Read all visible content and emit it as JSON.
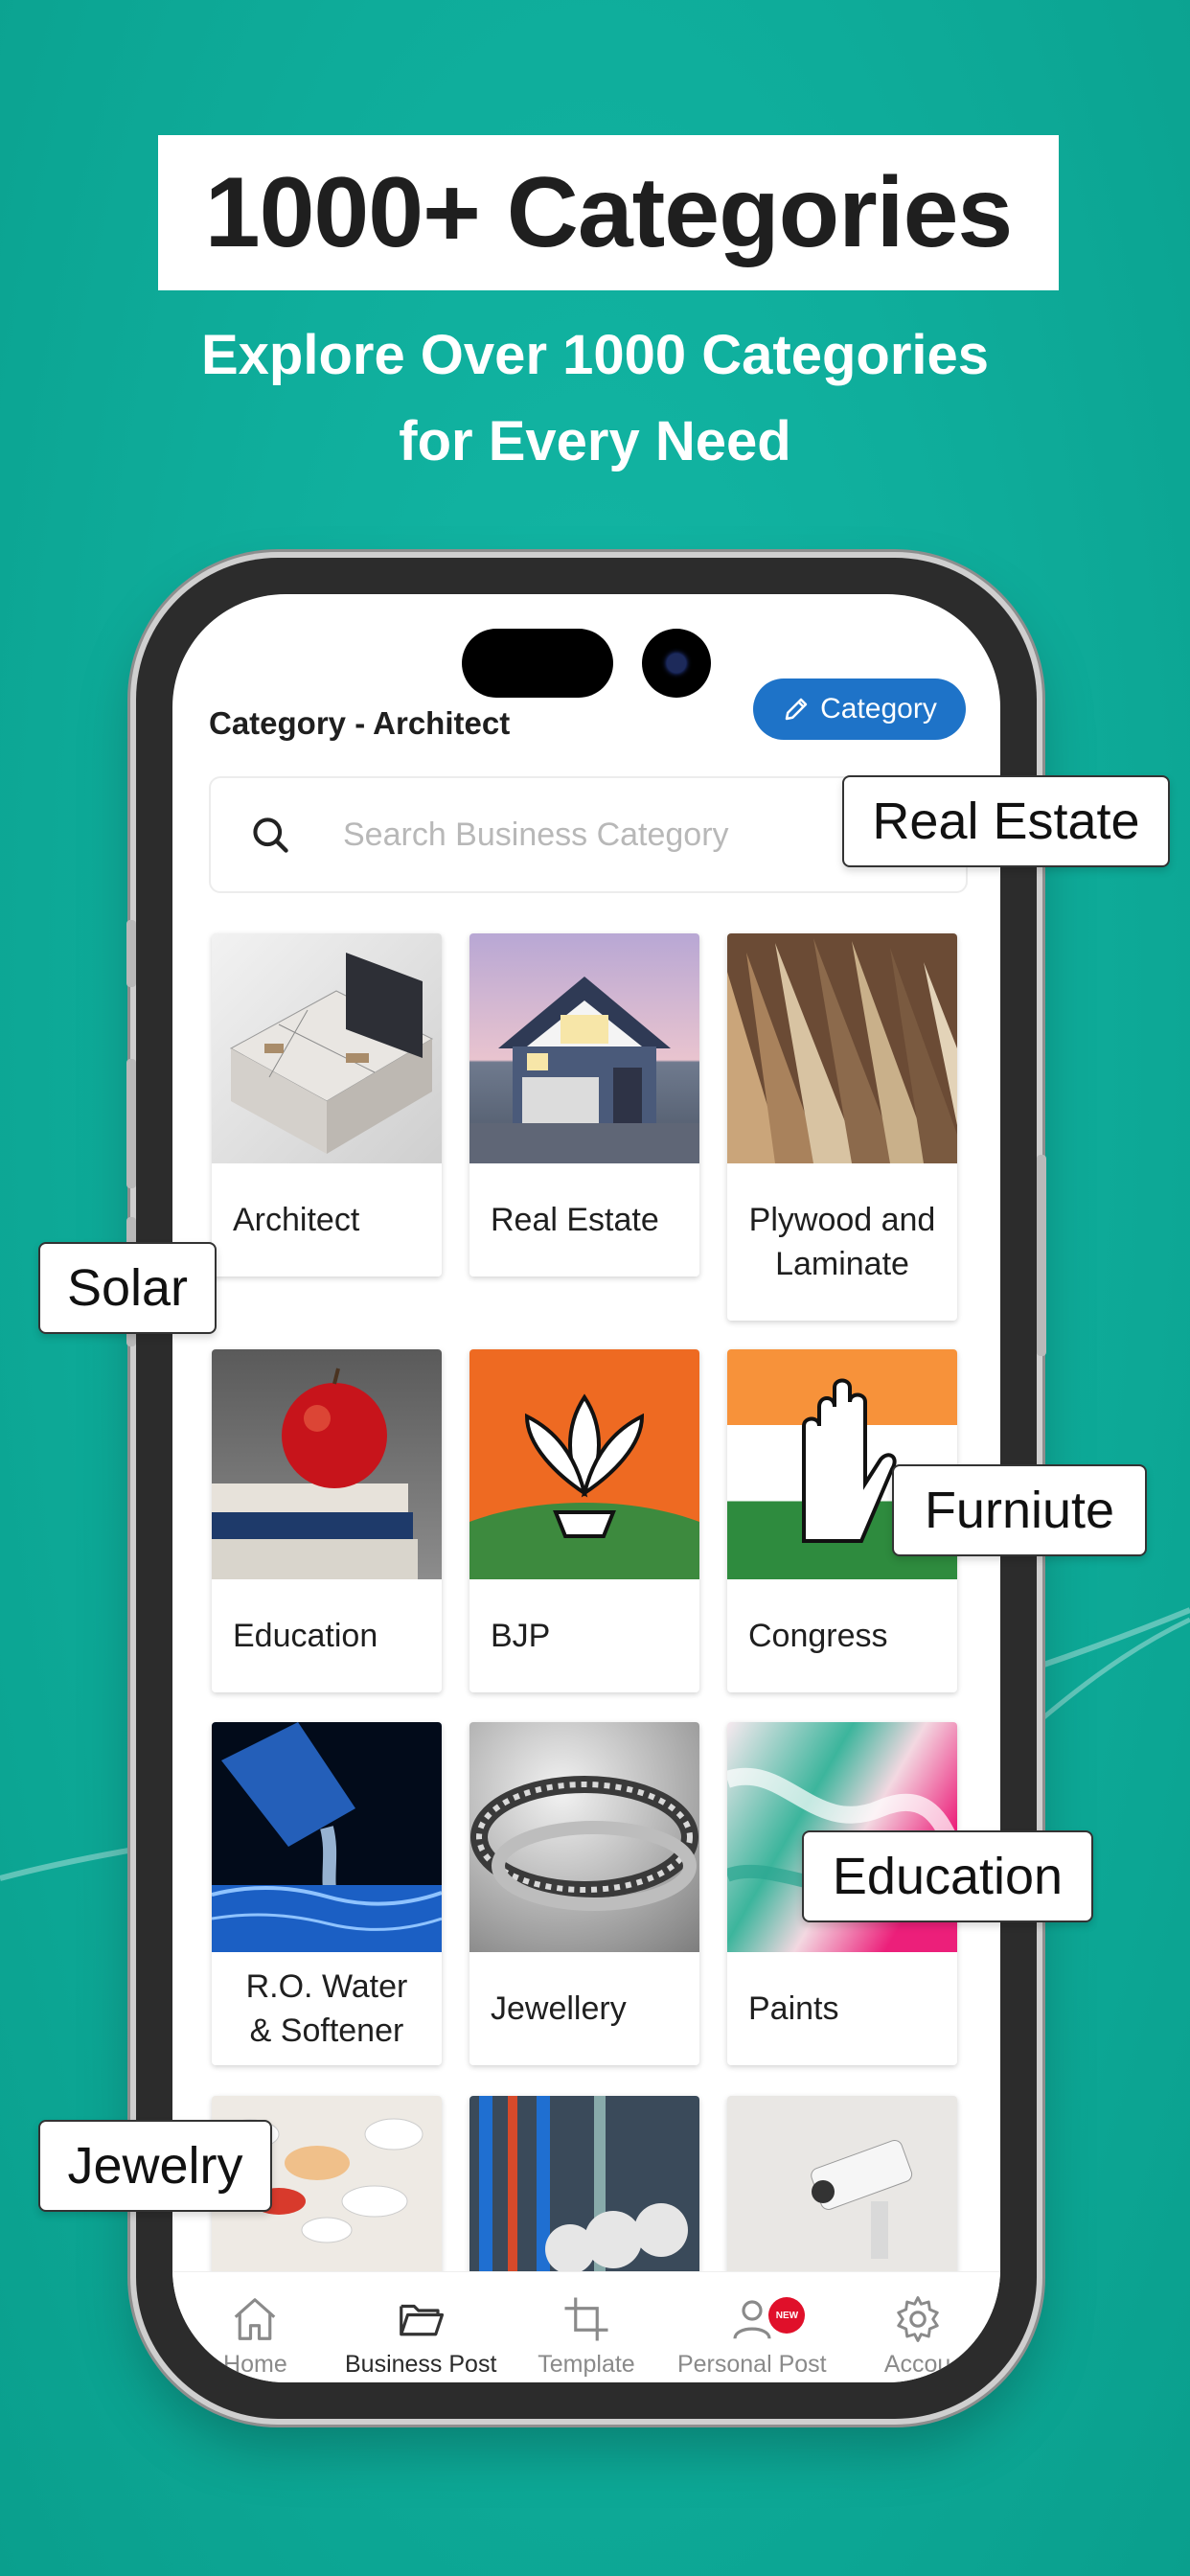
{
  "headline": "1000+ Categories",
  "subline": [
    "Explore Over 1000 Categories",
    "for Every Need"
  ],
  "app": {
    "page_title": "Category - Architect",
    "category_button": "Category",
    "search": {
      "placeholder": "Search Business Category",
      "value": ""
    },
    "tiles": [
      {
        "label": "Architect",
        "image": "architect-floorplan-image"
      },
      {
        "label": "Real Estate",
        "image": "house-image"
      },
      {
        "label": "Plywood and Laminate",
        "image": "laminate-samples-image"
      },
      {
        "label": "Education",
        "image": "apple-books-image"
      },
      {
        "label": "BJP",
        "image": "lotus-logo-image"
      },
      {
        "label": "Congress",
        "image": "hand-symbol-image"
      },
      {
        "label": "R.O. Water & Softener",
        "image": "water-bottle-image"
      },
      {
        "label": "Jewellery",
        "image": "rings-image"
      },
      {
        "label": "Paints",
        "image": "marble-paint-image"
      },
      {
        "label": "",
        "image": "pills-image"
      },
      {
        "label": "",
        "image": "pipes-image"
      },
      {
        "label": "",
        "image": "cctv-image"
      }
    ],
    "bottom_nav": [
      {
        "label": "Home",
        "icon": "home-icon"
      },
      {
        "label": "Business Post",
        "icon": "folder-icon",
        "active": true
      },
      {
        "label": "Template",
        "icon": "crop-icon"
      },
      {
        "label": "Personal Post",
        "icon": "user-icon",
        "badge": "NEW"
      },
      {
        "label": "Accou",
        "icon": "gear-icon"
      }
    ]
  },
  "floating_chips": [
    "Real Estate",
    "Solar",
    "Furniute",
    "Education",
    "Jewelry"
  ],
  "colors": {
    "background": "#10b3a0",
    "accent": "#1e73c8",
    "badge": "#e0102a"
  }
}
